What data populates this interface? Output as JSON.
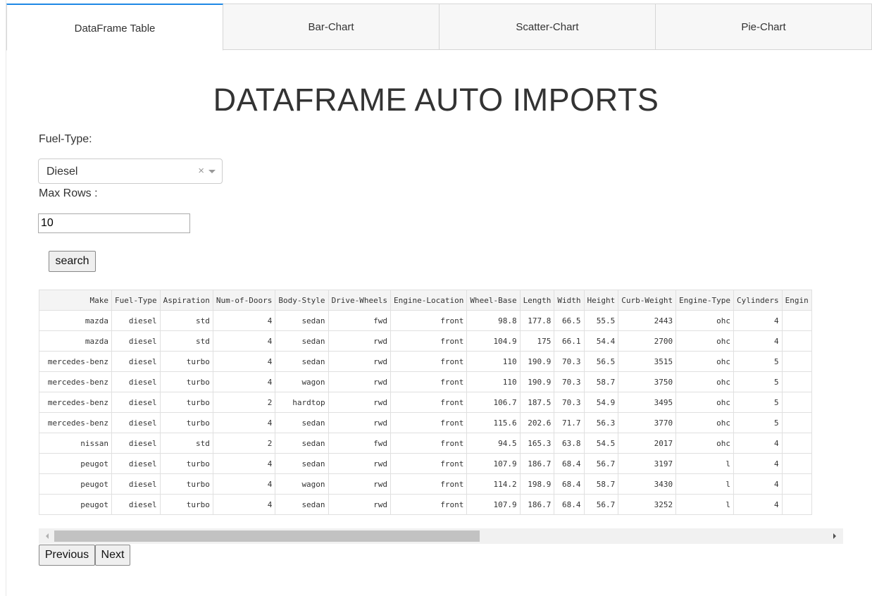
{
  "tabs": [
    {
      "label": "DataFrame Table",
      "active": true
    },
    {
      "label": "Bar-Chart",
      "active": false
    },
    {
      "label": "Scatter-Chart",
      "active": false
    },
    {
      "label": "Pie-Chart",
      "active": false
    }
  ],
  "title": "DATAFRAME AUTO IMPORTS",
  "fuel_type": {
    "label": "Fuel-Type:",
    "value": "Diesel",
    "clear_glyph": "×"
  },
  "max_rows": {
    "label": "Max Rows :",
    "value": "10"
  },
  "search_label": "search",
  "table": {
    "columns": [
      "Make",
      "Fuel-Type",
      "Aspiration",
      "Num-of-Doors",
      "Body-Style",
      "Drive-Wheels",
      "Engine-Location",
      "Wheel-Base",
      "Length",
      "Width",
      "Height",
      "Curb-Weight",
      "Engine-Type",
      "Cylinders",
      "Engin"
    ],
    "rows": [
      [
        "mazda",
        "diesel",
        "std",
        "4",
        "sedan",
        "fwd",
        "front",
        "98.8",
        "177.8",
        "66.5",
        "55.5",
        "2443",
        "ohc",
        "4",
        ""
      ],
      [
        "mazda",
        "diesel",
        "std",
        "4",
        "sedan",
        "rwd",
        "front",
        "104.9",
        "175",
        "66.1",
        "54.4",
        "2700",
        "ohc",
        "4",
        ""
      ],
      [
        "mercedes-benz",
        "diesel",
        "turbo",
        "4",
        "sedan",
        "rwd",
        "front",
        "110",
        "190.9",
        "70.3",
        "56.5",
        "3515",
        "ohc",
        "5",
        ""
      ],
      [
        "mercedes-benz",
        "diesel",
        "turbo",
        "4",
        "wagon",
        "rwd",
        "front",
        "110",
        "190.9",
        "70.3",
        "58.7",
        "3750",
        "ohc",
        "5",
        ""
      ],
      [
        "mercedes-benz",
        "diesel",
        "turbo",
        "2",
        "hardtop",
        "rwd",
        "front",
        "106.7",
        "187.5",
        "70.3",
        "54.9",
        "3495",
        "ohc",
        "5",
        ""
      ],
      [
        "mercedes-benz",
        "diesel",
        "turbo",
        "4",
        "sedan",
        "rwd",
        "front",
        "115.6",
        "202.6",
        "71.7",
        "56.3",
        "3770",
        "ohc",
        "5",
        ""
      ],
      [
        "nissan",
        "diesel",
        "std",
        "2",
        "sedan",
        "fwd",
        "front",
        "94.5",
        "165.3",
        "63.8",
        "54.5",
        "2017",
        "ohc",
        "4",
        ""
      ],
      [
        "peugot",
        "diesel",
        "turbo",
        "4",
        "sedan",
        "rwd",
        "front",
        "107.9",
        "186.7",
        "68.4",
        "56.7",
        "3197",
        "l",
        "4",
        ""
      ],
      [
        "peugot",
        "diesel",
        "turbo",
        "4",
        "wagon",
        "rwd",
        "front",
        "114.2",
        "198.9",
        "68.4",
        "58.7",
        "3430",
        "l",
        "4",
        ""
      ],
      [
        "peugot",
        "diesel",
        "turbo",
        "4",
        "sedan",
        "rwd",
        "front",
        "107.9",
        "186.7",
        "68.4",
        "56.7",
        "3252",
        "l",
        "4",
        ""
      ]
    ]
  },
  "pagination": {
    "previous": "Previous",
    "next": "Next"
  }
}
